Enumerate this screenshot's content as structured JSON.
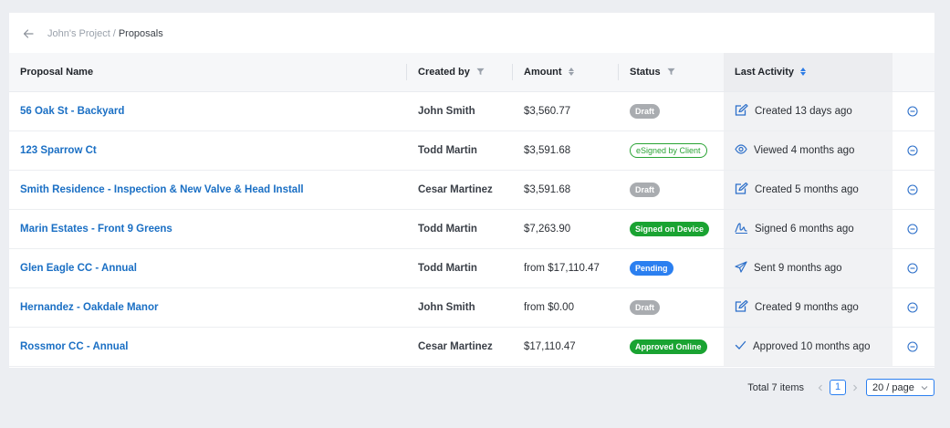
{
  "breadcrumb": {
    "project": "John's Project",
    "separator": "/",
    "current": "Proposals"
  },
  "columns": {
    "name": "Proposal Name",
    "created_by": "Created by",
    "amount": "Amount",
    "status": "Status",
    "last_activity": "Last Activity"
  },
  "rows": [
    {
      "name": "56 Oak St - Backyard",
      "created_by": "John Smith",
      "amount": "$3,560.77",
      "status": "Draft",
      "status_kind": "draft",
      "activity": "Created 13 days ago",
      "activity_icon": "edit-icon"
    },
    {
      "name": "123 Sparrow Ct",
      "created_by": "Todd Martin",
      "amount": "$3,591.68",
      "status": "eSigned by Client",
      "status_kind": "esigned",
      "activity": "Viewed 4 months ago",
      "activity_icon": "eye-icon"
    },
    {
      "name": "Smith Residence - Inspection & New Valve & Head Install",
      "created_by": "Cesar Martinez",
      "amount": "$3,591.68",
      "status": "Draft",
      "status_kind": "draft",
      "activity": "Created 5 months ago",
      "activity_icon": "edit-icon"
    },
    {
      "name": "Marin Estates - Front 9 Greens",
      "created_by": "Todd Martin",
      "amount": "$7,263.90",
      "status": "Signed on Device",
      "status_kind": "green",
      "activity": "Signed 6 months ago",
      "activity_icon": "signature-icon"
    },
    {
      "name": "Glen Eagle CC - Annual",
      "created_by": "Todd Martin",
      "amount": "from $17,110.47",
      "status": "Pending",
      "status_kind": "blue",
      "activity": "Sent 9 months ago",
      "activity_icon": "send-icon"
    },
    {
      "name": "Hernandez - Oakdale Manor",
      "created_by": "John Smith",
      "amount": "from $0.00",
      "status": "Draft",
      "status_kind": "draft",
      "activity": "Created 9 months ago",
      "activity_icon": "edit-icon"
    },
    {
      "name": "Rossmor CC - Annual",
      "created_by": "Cesar Martinez",
      "amount": "$17,110.47",
      "status": "Approved Online",
      "status_kind": "green",
      "activity": "Approved 10 months ago",
      "activity_icon": "check-icon"
    }
  ],
  "pagination": {
    "total": "Total 7 items",
    "current_page": "1",
    "page_size": "20 / page"
  },
  "colors": {
    "link": "#1a6fc4",
    "draft": "#a9acb0",
    "success": "#1aa332",
    "primary": "#2b7ff0"
  }
}
